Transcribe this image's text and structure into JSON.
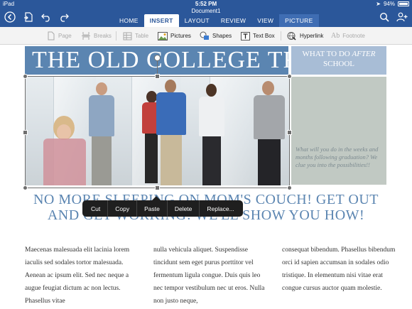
{
  "status": {
    "device": "iPad",
    "time": "5:52 PM",
    "battery": "94%"
  },
  "document": {
    "name": "Document1"
  },
  "tabs": [
    "HOME",
    "INSERT",
    "LAYOUT",
    "REVIEW",
    "VIEW",
    "PICTURE"
  ],
  "active_tab": "INSERT",
  "ribbon": {
    "page": "Page",
    "breaks": "Breaks",
    "table": "Table",
    "pictures": "Pictures",
    "shapes": "Shapes",
    "textbox": "Text Box",
    "hyperlink": "Hyperlink",
    "footnote_glyph": "Ab",
    "footnote": "Footnote"
  },
  "doc": {
    "title": "THE OLD COLLEGE TRY",
    "side_heading_line1": "WHAT TO DO",
    "side_heading_italic": "AFTER",
    "side_heading_line2": "SCHOOL",
    "side_quote": "What will you do in the weeks and months following graduation? We clue you into the possibilities!!",
    "headline_line1": "NO MORE SLEEPING ON MOM'S COUCH! GET OUT",
    "headline_line2": "AND GET WORKING! WE'LL SHOW YOU HOW!",
    "col1": "Maecenas malesuada elit lacinia lorem iaculis sed sodales tortor malesuada. Aenean ac ipsum elit. Sed nec neque a augue feugiat dictum ac non lectus. Phasellus vitae",
    "col2": "nulla vehicula aliquet. Suspendisse tincidunt sem eget purus porttitor vel fermentum ligula congue. Duis quis leo nec tempor vestibulum nec ut eros.  Nulla non justo neque,",
    "col3": "consequat bibendum. Phasellus bibendum orci id sapien accumsan in sodales odio tristique. In elementum nisi vitae erat congue cursus auctor quam molestie."
  },
  "context_menu": [
    "Cut",
    "Copy",
    "Paste",
    "Delete",
    "Replace..."
  ],
  "colors": {
    "ribbon": "#2b579a",
    "banner": "#5b85b1",
    "side_heading": "#a8bdd6",
    "side_box": "#c1c9c3",
    "headline": "#5b85b1"
  },
  "icons": [
    "back-icon",
    "file-icon",
    "undo-icon",
    "redo-icon",
    "search-icon",
    "add-person-icon"
  ]
}
